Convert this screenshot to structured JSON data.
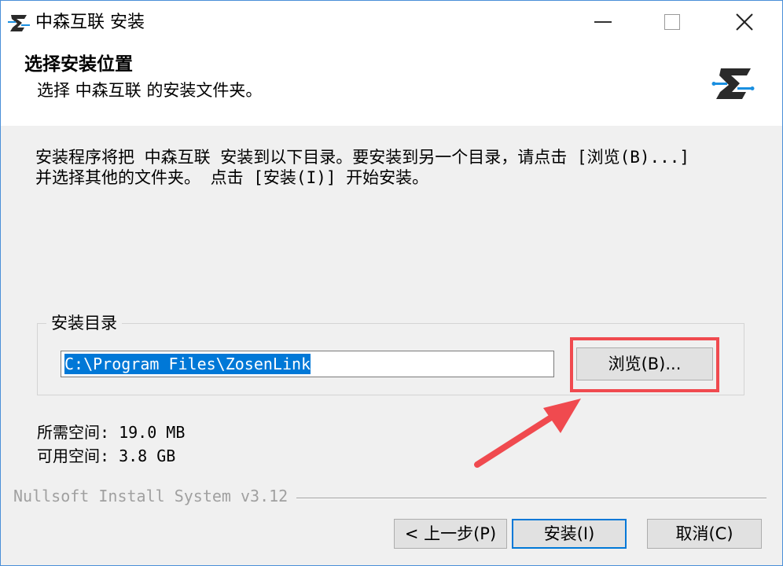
{
  "window": {
    "title": "中森互联 安装",
    "app_icon": "zosen-logo-icon",
    "controls": [
      "minimize-icon",
      "maximize-icon",
      "close-icon"
    ]
  },
  "header": {
    "title": "选择安装位置",
    "subtitle": "选择 中森互联 的安装文件夹。",
    "logo": "zosen-logo-icon"
  },
  "body": {
    "intro": "安装程序将把 中森互联 安装到以下目录。要安装到另一个目录，请点击 [浏览(B)...] 并选择其他的文件夹。 点击 [安装(I)] 开始安装。",
    "group_label": "安装目录",
    "directory_value": "C:\\Program Files\\ZosenLink",
    "browse_label": "浏览(B)...",
    "space_required": "所需空间: 19.0 MB",
    "space_available": "可用空间: 3.8 GB"
  },
  "footer": {
    "branding": "Nullsoft Install System v3.12",
    "back_label": "< 上一步(P)",
    "install_label": "安装(I)",
    "cancel_label": "取消(C)"
  },
  "colors": {
    "accent": "#0078d7",
    "highlight": "#f04a4f",
    "logo_blue": "#1a8fe0",
    "logo_dark": "#2a2a2a"
  }
}
